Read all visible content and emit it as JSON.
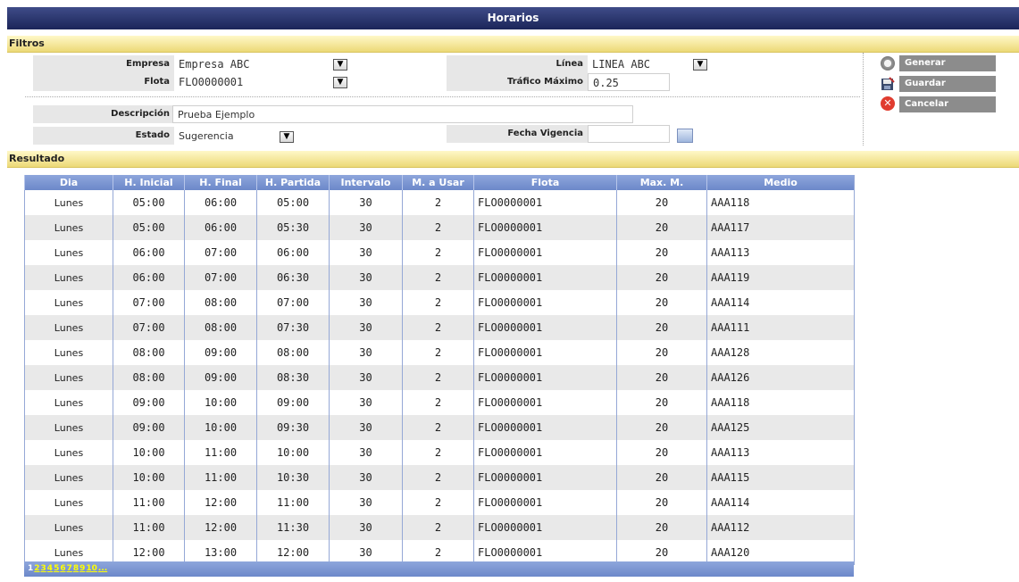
{
  "window": {
    "title": "Horarios"
  },
  "filters": {
    "section_title": "Filtros",
    "empresa": {
      "label": "Empresa",
      "value": "Empresa ABC"
    },
    "flota": {
      "label": "Flota",
      "value": "FLO0000001"
    },
    "linea": {
      "label": "Línea",
      "value": "LINEA ABC"
    },
    "trafico": {
      "label": "Tráfico Máximo",
      "value": "0.25"
    },
    "descripcion": {
      "label": "Descripción",
      "value": "Prueba Ejemplo"
    },
    "estado": {
      "label": "Estado",
      "value": "Sugerencia"
    },
    "fecha": {
      "label": "Fecha Vigencia",
      "value": ""
    }
  },
  "actions": {
    "generar": "Generar",
    "guardar": "Guardar",
    "cancelar": "Cancelar"
  },
  "results": {
    "section_title": "Resultado",
    "columns": [
      "Dia",
      "H. Inicial",
      "H. Final",
      "H. Partida",
      "Intervalo",
      "M. a Usar",
      "Flota",
      "Max. M.",
      "Medio"
    ],
    "rows": [
      [
        "Lunes",
        "05:00",
        "06:00",
        "05:00",
        "30",
        "2",
        "FLO0000001",
        "20",
        "AAA118"
      ],
      [
        "Lunes",
        "05:00",
        "06:00",
        "05:30",
        "30",
        "2",
        "FLO0000001",
        "20",
        "AAA117"
      ],
      [
        "Lunes",
        "06:00",
        "07:00",
        "06:00",
        "30",
        "2",
        "FLO0000001",
        "20",
        "AAA113"
      ],
      [
        "Lunes",
        "06:00",
        "07:00",
        "06:30",
        "30",
        "2",
        "FLO0000001",
        "20",
        "AAA119"
      ],
      [
        "Lunes",
        "07:00",
        "08:00",
        "07:00",
        "30",
        "2",
        "FLO0000001",
        "20",
        "AAA114"
      ],
      [
        "Lunes",
        "07:00",
        "08:00",
        "07:30",
        "30",
        "2",
        "FLO0000001",
        "20",
        "AAA111"
      ],
      [
        "Lunes",
        "08:00",
        "09:00",
        "08:00",
        "30",
        "2",
        "FLO0000001",
        "20",
        "AAA128"
      ],
      [
        "Lunes",
        "08:00",
        "09:00",
        "08:30",
        "30",
        "2",
        "FLO0000001",
        "20",
        "AAA126"
      ],
      [
        "Lunes",
        "09:00",
        "10:00",
        "09:00",
        "30",
        "2",
        "FLO0000001",
        "20",
        "AAA118"
      ],
      [
        "Lunes",
        "09:00",
        "10:00",
        "09:30",
        "30",
        "2",
        "FLO0000001",
        "20",
        "AAA125"
      ],
      [
        "Lunes",
        "10:00",
        "11:00",
        "10:00",
        "30",
        "2",
        "FLO0000001",
        "20",
        "AAA113"
      ],
      [
        "Lunes",
        "10:00",
        "11:00",
        "10:30",
        "30",
        "2",
        "FLO0000001",
        "20",
        "AAA115"
      ],
      [
        "Lunes",
        "11:00",
        "12:00",
        "11:00",
        "30",
        "2",
        "FLO0000001",
        "20",
        "AAA114"
      ],
      [
        "Lunes",
        "11:00",
        "12:00",
        "11:30",
        "30",
        "2",
        "FLO0000001",
        "20",
        "AAA112"
      ],
      [
        "Lunes",
        "12:00",
        "13:00",
        "12:00",
        "30",
        "2",
        "FLO0000001",
        "20",
        "AAA120"
      ]
    ],
    "pager": {
      "current": "1",
      "pages": [
        "2",
        "3",
        "4",
        "5",
        "6",
        "7",
        "8",
        "9",
        "10",
        "..."
      ]
    }
  },
  "icons": {
    "generar": "gear-icon",
    "guardar": "save-icon",
    "cancelar": "cancel-icon",
    "fecha": "calendar-icon",
    "dropdown": "chevron-down-icon"
  },
  "colors": {
    "title_bar": "#1b2559",
    "section_bar": "#ecd977",
    "table_header": "#6c88c9",
    "button": "#8c8c8c",
    "cancel": "#e03c2f"
  }
}
